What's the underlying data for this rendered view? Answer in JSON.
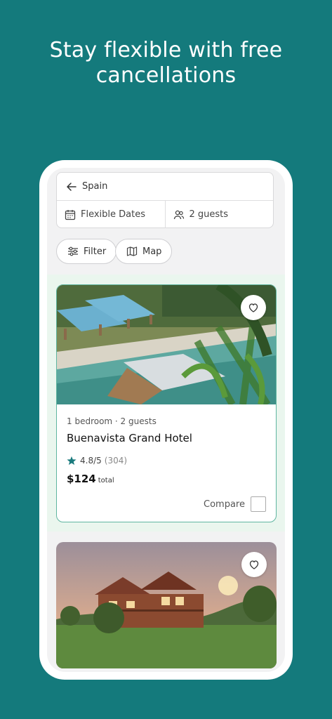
{
  "headline": [
    "Stay flexible with free",
    "cancellations"
  ],
  "search": {
    "destination": "Spain",
    "dates": "Flexible Dates",
    "guests": "2 guests"
  },
  "chips": {
    "filter": "Filter",
    "map": "Map"
  },
  "listings": [
    {
      "details": "1 bedroom · 2 guests",
      "name": "Buenavista Grand Hotel",
      "rating": "4.8/5",
      "reviews": "(304)",
      "price": "$124",
      "price_suffix": "total",
      "compare_label": "Compare"
    }
  ],
  "icons": [
    "arrow-left-icon",
    "calendar-icon",
    "people-icon",
    "sliders-icon",
    "map-icon",
    "heart-icon",
    "star-icon"
  ],
  "colors": {
    "background": "#147a7c",
    "accent": "#1a7a7d",
    "highlight": "#eaf6ee",
    "card_border": "#5fb5a0"
  }
}
